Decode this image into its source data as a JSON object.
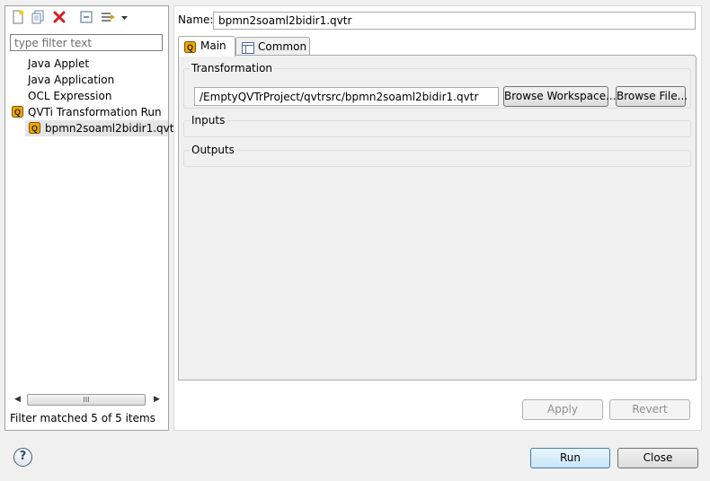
{
  "left_pane": {
    "toolbar_icons": [
      "new-config-icon",
      "duplicate-icon",
      "delete-icon",
      "collapse-all-icon",
      "filter-icon",
      "view-menu-icon"
    ],
    "filter_placeholder": "type filter text",
    "tree": [
      {
        "label": "Java Applet",
        "level": 1,
        "icon": ""
      },
      {
        "label": "Java Application",
        "level": 1,
        "icon": ""
      },
      {
        "label": "OCL Expression",
        "level": 1,
        "icon": ""
      },
      {
        "label": "QVTi Transformation Run",
        "level": 1,
        "icon": "qvt-icon"
      },
      {
        "label": "bpmn2soaml2bidir1.qvtr",
        "level": 2,
        "icon": "qvt-icon",
        "selected": true
      }
    ],
    "scrollbar_grip": "III",
    "status": "Filter matched 5 of 5 items"
  },
  "config": {
    "name_label": "Name:",
    "name_value": "bpmn2soaml2bidir1.qvtr",
    "tabs": [
      {
        "label": "Main",
        "icon": "qvt-icon",
        "active": true
      },
      {
        "label": "Common",
        "icon": "common-tab-icon",
        "active": false
      }
    ],
    "transformation": {
      "title": "Transformation",
      "path": "/EmptyQVTrProject/qvtrsrc/bpmn2soaml2bidir1.qvtr",
      "browse_workspace": "Browse Workspace...",
      "browse_file": "Browse File..."
    },
    "inputs_title": "Inputs",
    "outputs_title": "Outputs",
    "apply_label": "Apply",
    "revert_label": "Revert"
  },
  "footer": {
    "help_symbol": "?",
    "run_label": "Run",
    "close_label": "Close"
  },
  "colors": {
    "selection": "#e5e5e5",
    "qvt_icon_fill": "#f0a800",
    "delete_red": "#d02020",
    "default_button_border": "#3c7fb1"
  }
}
